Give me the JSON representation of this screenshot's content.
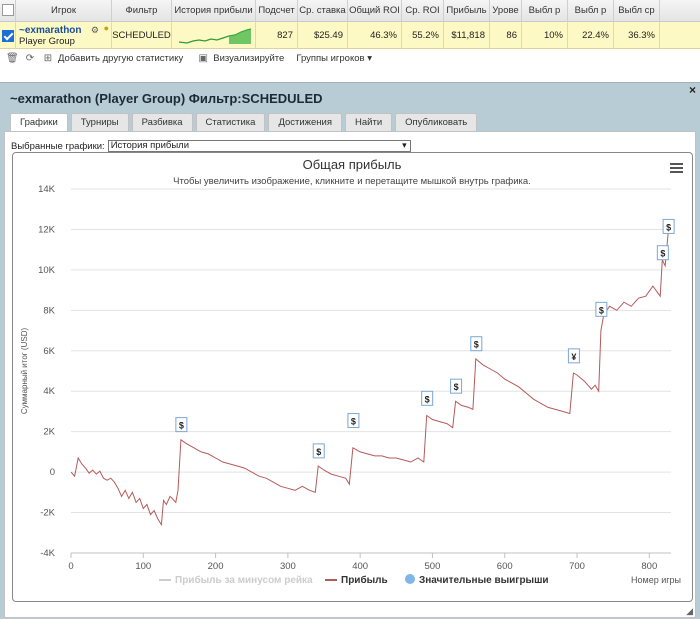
{
  "table": {
    "headers": [
      "",
      "Игрок",
      "Фильтр",
      "История прибыли",
      "Подсчет",
      "Ср. ставка",
      "Общий ROI",
      "Ср. ROI",
      "Прибыль",
      "Урове",
      "Выбл р",
      "Выбл р",
      "Выбл ср"
    ],
    "row": {
      "player": "~exmarathon",
      "group": "Player Group",
      "filter": "SCHEDULED",
      "count": "827",
      "avg_stake": "$25.49",
      "total_roi": "46.3%",
      "avg_roi": "55.2%",
      "profit": "$11,818",
      "level": "86",
      "cash1": "10%",
      "cash2": "22.4%",
      "cash3": "36.3%"
    }
  },
  "toolbar": {
    "add_stats": "Добавить другую статистику",
    "visualize": "Визуализируйте",
    "groups": "Группы игроков"
  },
  "panel": {
    "title": "~exmarathon (Player Group) Фильтр:SCHEDULED",
    "close": "×",
    "tabs": [
      "Графики",
      "Турниры",
      "Разбивка",
      "Статистика",
      "Достижения",
      "Найти",
      "Опубликовать"
    ],
    "selected_label": "Выбранные графики:",
    "selected_value": "История прибыли"
  },
  "chart_data": {
    "type": "line",
    "title": "Общая прибыль",
    "subtitle": "Чтобы увеличить изображение, кликните и перетащите мышкой внутрь графика.",
    "ylabel": "Суммарный итог (USD)",
    "xlabel": "Номер игры",
    "xlim": [
      0,
      830
    ],
    "ylim": [
      -4000,
      14000
    ],
    "xticks": [
      0,
      100,
      200,
      300,
      400,
      500,
      600,
      700,
      800
    ],
    "yticks": [
      -4000,
      -2000,
      0,
      2000,
      4000,
      6000,
      8000,
      10000,
      12000,
      14000
    ],
    "ytick_labels": [
      "-4K",
      "-2K",
      "0",
      "2K",
      "4K",
      "6K",
      "8K",
      "10K",
      "12K",
      "14K"
    ],
    "legend": [
      "Прибыль за минусом рейка",
      "Прибыль",
      "Значительные выигрыши"
    ],
    "series_color": "#b55a5a",
    "points": [
      [
        0,
        0
      ],
      [
        5,
        -200
      ],
      [
        10,
        700
      ],
      [
        15,
        400
      ],
      [
        20,
        200
      ],
      [
        25,
        -50
      ],
      [
        30,
        100
      ],
      [
        35,
        -100
      ],
      [
        40,
        50
      ],
      [
        45,
        -300
      ],
      [
        50,
        -400
      ],
      [
        55,
        -300
      ],
      [
        60,
        -500
      ],
      [
        65,
        -800
      ],
      [
        70,
        -1200
      ],
      [
        75,
        -900
      ],
      [
        80,
        -1300
      ],
      [
        85,
        -1000
      ],
      [
        90,
        -1500
      ],
      [
        95,
        -1300
      ],
      [
        100,
        -1800
      ],
      [
        105,
        -1600
      ],
      [
        110,
        -2100
      ],
      [
        115,
        -1900
      ],
      [
        120,
        -2300
      ],
      [
        125,
        -2600
      ],
      [
        128,
        -1400
      ],
      [
        132,
        -1600
      ],
      [
        137,
        -1200
      ],
      [
        140,
        -1300
      ],
      [
        145,
        -1500
      ],
      [
        148,
        -900
      ],
      [
        152,
        1600
      ],
      [
        160,
        1400
      ],
      [
        170,
        1200
      ],
      [
        180,
        1000
      ],
      [
        190,
        900
      ],
      [
        200,
        700
      ],
      [
        210,
        500
      ],
      [
        220,
        400
      ],
      [
        230,
        300
      ],
      [
        240,
        200
      ],
      [
        250,
        0
      ],
      [
        260,
        -200
      ],
      [
        270,
        -300
      ],
      [
        280,
        -500
      ],
      [
        290,
        -700
      ],
      [
        300,
        -800
      ],
      [
        310,
        -900
      ],
      [
        320,
        -700
      ],
      [
        330,
        -900
      ],
      [
        338,
        -1000
      ],
      [
        342,
        300
      ],
      [
        350,
        100
      ],
      [
        360,
        -100
      ],
      [
        370,
        -200
      ],
      [
        380,
        -300
      ],
      [
        385,
        -600
      ],
      [
        390,
        1200
      ],
      [
        400,
        1000
      ],
      [
        410,
        900
      ],
      [
        420,
        800
      ],
      [
        430,
        800
      ],
      [
        440,
        700
      ],
      [
        450,
        700
      ],
      [
        460,
        600
      ],
      [
        470,
        500
      ],
      [
        480,
        700
      ],
      [
        488,
        500
      ],
      [
        492,
        2800
      ],
      [
        500,
        2600
      ],
      [
        510,
        2500
      ],
      [
        520,
        2400
      ],
      [
        528,
        2200
      ],
      [
        532,
        3500
      ],
      [
        540,
        3300
      ],
      [
        550,
        3200
      ],
      [
        556,
        3100
      ],
      [
        560,
        5600
      ],
      [
        570,
        5300
      ],
      [
        580,
        5100
      ],
      [
        590,
        4900
      ],
      [
        600,
        4600
      ],
      [
        610,
        4400
      ],
      [
        620,
        4200
      ],
      [
        630,
        3900
      ],
      [
        640,
        3600
      ],
      [
        650,
        3400
      ],
      [
        660,
        3200
      ],
      [
        670,
        3100
      ],
      [
        680,
        3000
      ],
      [
        690,
        2900
      ],
      [
        695,
        4900
      ],
      [
        700,
        4800
      ],
      [
        710,
        4500
      ],
      [
        720,
        4100
      ],
      [
        725,
        4300
      ],
      [
        730,
        4000
      ],
      [
        733,
        7000
      ],
      [
        737,
        7800
      ],
      [
        745,
        8200
      ],
      [
        755,
        8000
      ],
      [
        765,
        8400
      ],
      [
        775,
        8200
      ],
      [
        785,
        8600
      ],
      [
        795,
        8700
      ],
      [
        805,
        9200
      ],
      [
        815,
        8700
      ],
      [
        818,
        10500
      ],
      [
        822,
        10200
      ],
      [
        826,
        11800
      ],
      [
        830,
        12000
      ]
    ],
    "markers": [
      {
        "x": 152,
        "y": 2300,
        "label": "$"
      },
      {
        "x": 342,
        "y": 1000,
        "label": "$"
      },
      {
        "x": 390,
        "y": 2500,
        "label": "$"
      },
      {
        "x": 492,
        "y": 3600,
        "label": "$"
      },
      {
        "x": 532,
        "y": 4200,
        "label": "$"
      },
      {
        "x": 560,
        "y": 6300,
        "label": "$"
      },
      {
        "x": 695,
        "y": 5700,
        "label": "¥"
      },
      {
        "x": 733,
        "y": 8000,
        "label": "$"
      },
      {
        "x": 818,
        "y": 10800,
        "label": "$"
      },
      {
        "x": 826,
        "y": 12100,
        "label": "$"
      }
    ]
  }
}
